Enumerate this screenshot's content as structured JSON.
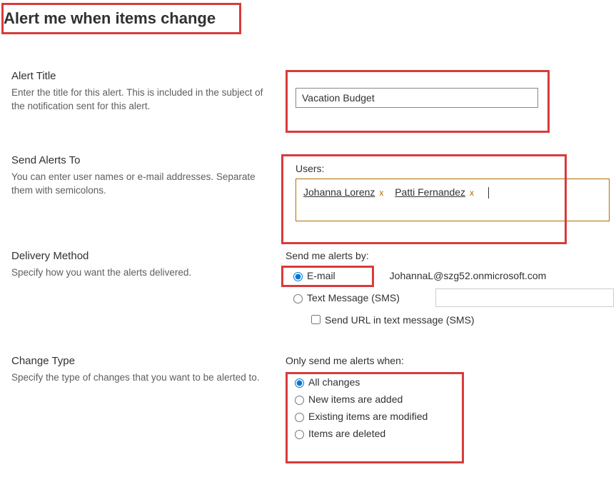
{
  "page_title": "Alert me when items change",
  "sections": {
    "alert_title": {
      "heading": "Alert Title",
      "desc": "Enter the title for this alert. This is included in the subject of the notification sent for this alert.",
      "value": "Vacation Budget"
    },
    "send_to": {
      "heading": "Send Alerts To",
      "desc": "You can enter user names or e-mail addresses. Separate them with semicolons.",
      "users_label": "Users:",
      "users": [
        "Johanna Lorenz",
        "Patti Fernandez"
      ]
    },
    "delivery": {
      "heading": "Delivery Method",
      "desc": "Specify how you want the alerts delivered.",
      "group_label": "Send me alerts by:",
      "options": {
        "email": "E-mail",
        "sms": "Text Message (SMS)"
      },
      "email_value": "JohannaL@szg52.onmicrosoft.com",
      "sms_url_checkbox": "Send URL in text message (SMS)"
    },
    "change_type": {
      "heading": "Change Type",
      "desc": "Specify the type of changes that you want to be alerted to.",
      "group_label": "Only send me alerts when:",
      "options": {
        "all": "All changes",
        "new": "New items are added",
        "modified": "Existing items are modified",
        "deleted": "Items are deleted"
      }
    }
  }
}
